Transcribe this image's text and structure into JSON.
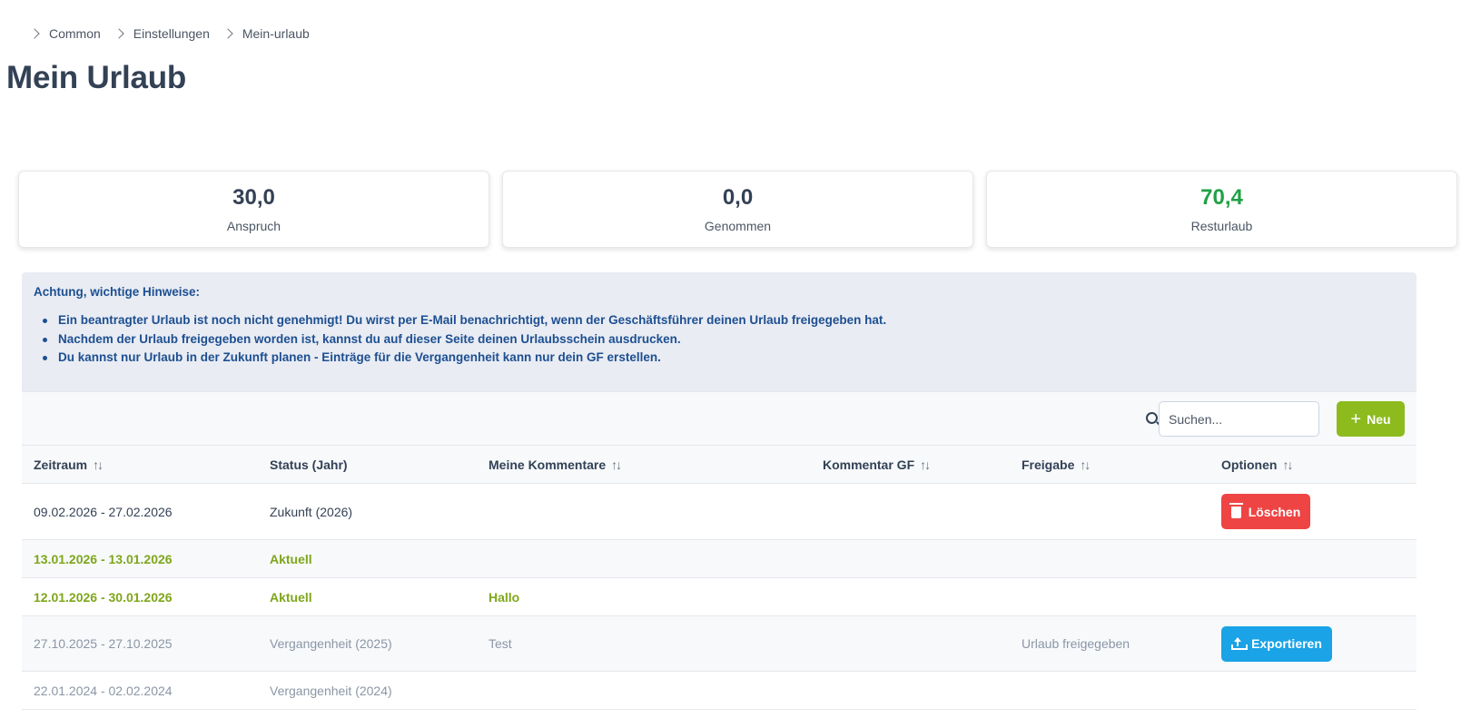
{
  "breadcrumb": [
    "Common",
    "Einstellungen",
    "Mein-urlaub"
  ],
  "page_title": "Mein Urlaub",
  "stats": [
    {
      "value": "30,0",
      "label": "Anspruch"
    },
    {
      "value": "0,0",
      "label": "Genommen"
    },
    {
      "value": "70,4",
      "label": "Resturlaub",
      "color": "#22a045"
    }
  ],
  "notice": {
    "title": "Achtung, wichtige Hinweise:",
    "items": [
      "Ein beantragter Urlaub ist noch nicht genehmigt! Du wirst per E-Mail benachrichtigt, wenn der Geschäftsführer deinen Urlaub freigegeben hat.",
      "Nachdem der Urlaub freigegeben worden ist, kannst du auf dieser Seite deinen Urlaubsschein ausdrucken.",
      "Du kannst nur Urlaub in der Zukunft planen - Einträge für die Vergangenheit kann nur dein GF erstellen."
    ]
  },
  "toolbar": {
    "search_placeholder": "Suchen...",
    "new_label": "Neu"
  },
  "table": {
    "columns": [
      "Zeitraum",
      "Status (Jahr)",
      "Meine Kommentare",
      "Kommentar GF",
      "Freigabe",
      "Optionen"
    ],
    "sortable": [
      true,
      false,
      true,
      true,
      true,
      true
    ],
    "sort_glyph": "↑↓",
    "rows": [
      {
        "zeitraum": "09.02.2026 - 27.02.2026",
        "status": "Zukunft (2026)",
        "kommentar": "",
        "kommentar_gf": "",
        "freigabe": "",
        "action": "Löschen",
        "style": "normal"
      },
      {
        "zeitraum": "13.01.2026 - 13.01.2026",
        "status": "Aktuell",
        "kommentar": "",
        "kommentar_gf": "",
        "freigabe": "",
        "action": "",
        "style": "green"
      },
      {
        "zeitraum": "12.01.2026 - 30.01.2026",
        "status": "Aktuell",
        "kommentar": "Hallo",
        "kommentar_gf": "",
        "freigabe": "",
        "action": "",
        "style": "green"
      },
      {
        "zeitraum": "27.10.2025 - 27.10.2025",
        "status": "Vergangenheit (2025)",
        "kommentar": "Test",
        "kommentar_gf": "",
        "freigabe": "Urlaub freigegeben",
        "action": "Exportieren",
        "style": "grey"
      },
      {
        "zeitraum": "22.01.2024 - 02.02.2024",
        "status": "Vergangenheit (2024)",
        "kommentar": "",
        "kommentar_gf": "",
        "freigabe": "",
        "action": "",
        "style": "grey"
      }
    ]
  },
  "colors": {
    "accent_green": "#8dbb1e",
    "danger": "#ef4444",
    "info": "#1aa3e6",
    "notice_text": "#1d4f91"
  }
}
